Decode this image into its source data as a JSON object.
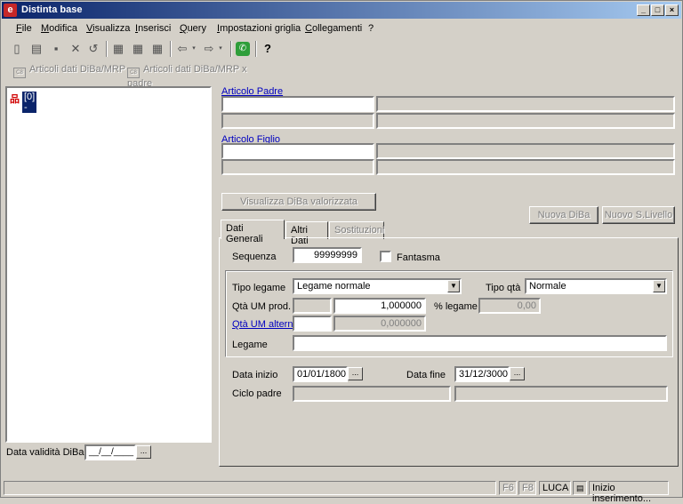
{
  "window": {
    "title": "Distinta base",
    "app_icon": "e",
    "controls": {
      "minimize": "_",
      "maximize": "□",
      "close": "×"
    }
  },
  "menu": [
    "File",
    "Modifica",
    "Visualizza",
    "Inserisci",
    "Query",
    "Impostazioni griglia",
    "Collegamenti",
    "?"
  ],
  "toolbar_icons": [
    "new-document-icon",
    "open-icon",
    "save-icon",
    "delete-icon",
    "undo-icon",
    "grid-expand-icon",
    "grid-icon",
    "grid-collapse-icon",
    "back-arrow-icon",
    "forward-arrow-icon",
    "phone-icon",
    "help-icon"
  ],
  "links": {
    "articoli_mrp": "Articoli dati DiBa/MRP",
    "articoli_mrp_padre": "Articoli dati DiBa/MRP x padre"
  },
  "tree": {
    "root_label": "[0] -"
  },
  "validity": {
    "label": "Data validità DiBa",
    "value": "__/__/____",
    "picker": "..."
  },
  "articolo_padre": {
    "label": "Articolo Padre",
    "code": "",
    "desc": "",
    "extra1": "",
    "extra2": ""
  },
  "articolo_figlio": {
    "label": "Articolo Figlio",
    "code": "",
    "desc": "",
    "extra1": "",
    "extra2": ""
  },
  "buttons": {
    "visualizza": "Visualizza DiBa valorizzata",
    "nuova_diba": "Nuova DiBa",
    "nuovo_livello": "Nuovo S.Livello"
  },
  "tabs": [
    "Dati Generali",
    "Altri Dati",
    "Sostituzioni"
  ],
  "form": {
    "sequenza_label": "Sequenza",
    "sequenza_value": "99999999",
    "fantasma_label": "Fantasma",
    "fantasma_checked": false,
    "tipo_legame_label": "Tipo legame",
    "tipo_legame_value": "Legame normale",
    "tipo_qta_label": "Tipo qtà",
    "tipo_qta_value": "Normale",
    "qta_um_prod_label": "Qtà UM prod.",
    "qta_um_prod_value": "1,000000",
    "perc_legame_label": "% legame",
    "perc_legame_value": "0,00",
    "qta_um_altern_label": "Qtà UM altern.",
    "qta_um_altern_value": "0,000000",
    "legame_label": "Legame",
    "legame_value": "",
    "data_inizio_label": "Data inizio",
    "data_inizio_value": "01/01/1800",
    "data_fine_label": "Data fine",
    "data_fine_value": "31/12/3000",
    "ciclo_padre_label": "Ciclo padre",
    "date_picker": "..."
  },
  "status": {
    "f6": "F6",
    "f8": "F8",
    "user": "LUCA",
    "message": "Inizio inserimento..."
  }
}
